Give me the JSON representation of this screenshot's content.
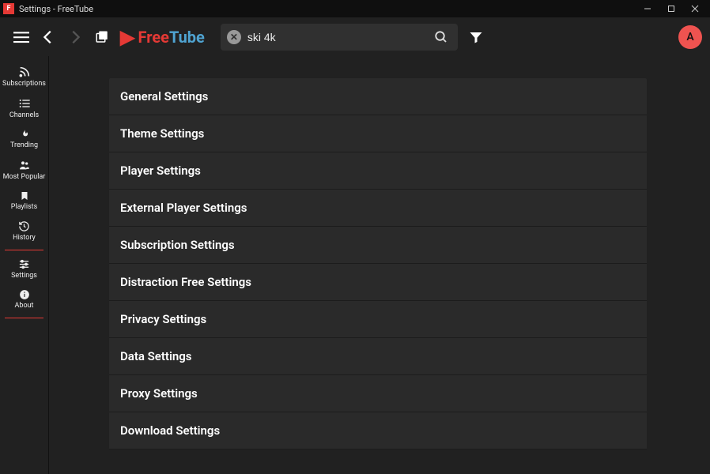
{
  "window": {
    "title": "Settings - FreeTube"
  },
  "logo": {
    "free": "Free",
    "tube": "Tube"
  },
  "search": {
    "value": "ski 4k",
    "placeholder": ""
  },
  "profile": {
    "letter": "A"
  },
  "sidebar": {
    "items": [
      {
        "label": "Subscriptions"
      },
      {
        "label": "Channels"
      },
      {
        "label": "Trending"
      },
      {
        "label": "Most Popular"
      },
      {
        "label": "Playlists"
      },
      {
        "label": "History"
      }
    ],
    "bottom": [
      {
        "label": "Settings"
      },
      {
        "label": "About"
      }
    ]
  },
  "settings": {
    "rows": [
      "General Settings",
      "Theme Settings",
      "Player Settings",
      "External Player Settings",
      "Subscription Settings",
      "Distraction Free Settings",
      "Privacy Settings",
      "Data Settings",
      "Proxy Settings",
      "Download Settings"
    ]
  }
}
